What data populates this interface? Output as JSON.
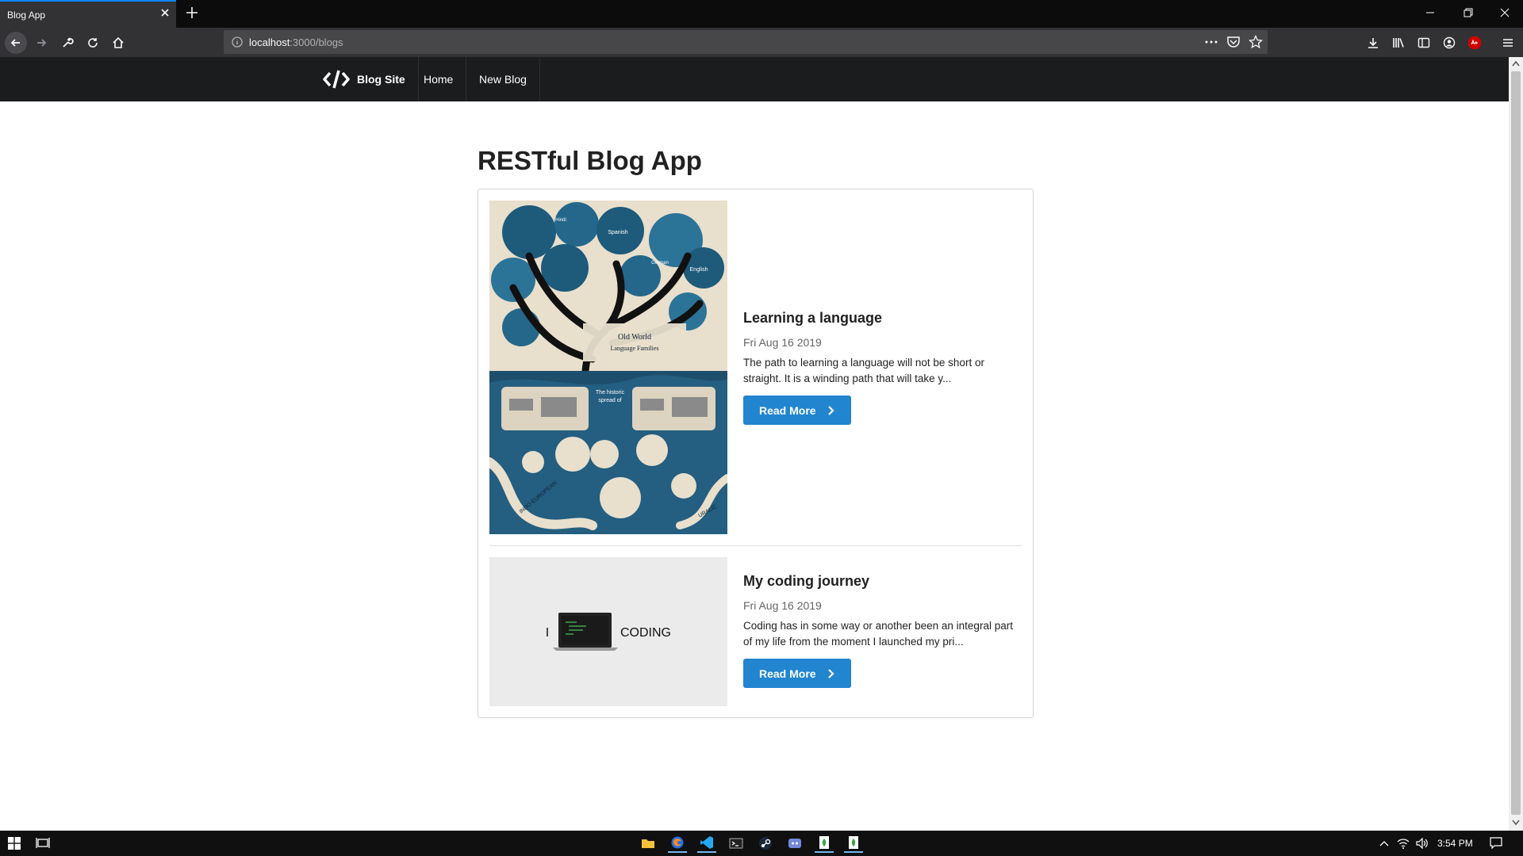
{
  "browser": {
    "tab_title": "Blog App",
    "url_host": "localhost",
    "url_rest": ":3000/blogs"
  },
  "site_nav": {
    "brand": "Blog Site",
    "links": [
      "Home",
      "New Blog"
    ]
  },
  "page": {
    "title": "RESTful Blog App"
  },
  "posts": [
    {
      "title": "Learning a language",
      "date": "Fri Aug 16 2019",
      "excerpt": "The path to learning a language will not be short or straight. It is a winding path that will take y...",
      "button": "Read More"
    },
    {
      "title": "My coding journey",
      "date": "Fri Aug 16 2019",
      "excerpt": "Coding has in some way or another been an integral part of my life from the moment I launched my pri...",
      "button": "Read More",
      "image_text_left": "I",
      "image_text_right": "CODING"
    }
  ],
  "poster": {
    "title_line1": "Old World",
    "title_line2": "Language Families",
    "lang_1": "Spanish",
    "lang_2": "English",
    "lang_3": "Hindi",
    "lang_4": "German",
    "root_1": "INDO-EUROPEAN",
    "root_2": "URALIC",
    "map_caption_1": "The historic",
    "map_caption_2": "spread of"
  },
  "taskbar": {
    "time": "3:54 PM"
  },
  "colors": {
    "accent": "#2185d0",
    "site_nav_bg": "#1b1c1d"
  }
}
